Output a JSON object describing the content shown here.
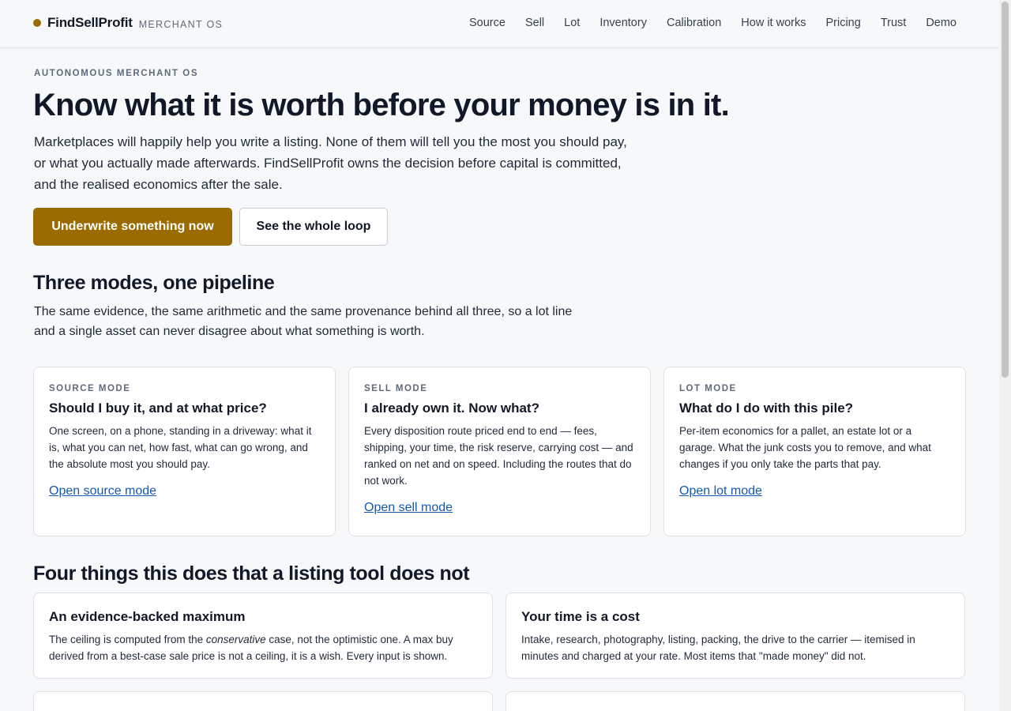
{
  "header": {
    "brand_name": "FindSellProfit",
    "brand_tag": "MERCHANT OS",
    "nav": [
      "Source",
      "Sell",
      "Lot",
      "Inventory",
      "Calibration",
      "How it works",
      "Pricing",
      "Trust",
      "Demo"
    ]
  },
  "hero": {
    "eyebrow": "AUTONOMOUS MERCHANT OS",
    "title": "Know what it is worth before your money is in it.",
    "lede": "Marketplaces will happily help you write a listing. None of them will tell you the most you should pay, or what you actually made afterwards. FindSellProfit owns the decision before capital is committed, and the realised economics after the sale.",
    "primary_cta": "Underwrite something now",
    "secondary_cta": "See the whole loop"
  },
  "modes": {
    "title": "Three modes, one pipeline",
    "lede": "The same evidence, the same arithmetic and the same provenance behind all three, so a lot line and a single asset can never disagree about what something is worth.",
    "cards": [
      {
        "eyebrow": "SOURCE MODE",
        "title": "Should I buy it, and at what price?",
        "body": "One screen, on a phone, standing in a driveway: what it is, what you can net, how fast, what can go wrong, and the absolute most you should pay.",
        "link": "Open source mode"
      },
      {
        "eyebrow": "SELL MODE",
        "title": "I already own it. Now what?",
        "body": "Every disposition route priced end to end — fees, shipping, your time, the risk reserve, carrying cost — and ranked on net and on speed. Including the routes that do not work.",
        "link": "Open sell mode"
      },
      {
        "eyebrow": "LOT MODE",
        "title": "What do I do with this pile?",
        "body": "Per-item economics for a pallet, an estate lot or a garage. What the junk costs you to remove, and what changes if you only take the parts that pay.",
        "link": "Open lot mode"
      }
    ]
  },
  "features": {
    "title": "Four things this does that a listing tool does not",
    "cards": [
      {
        "title": "An evidence-backed maximum",
        "body_pre": "The ceiling is computed from the ",
        "body_em": "conservative",
        "body_post": " case, not the optimistic one. A max buy derived from a best-case sale price is not a ceiling, it is a wish. Every input is shown."
      },
      {
        "title": "Your time is a cost",
        "body": "Intake, research, photography, listing, packing, the drive to the carrier — itemised in minutes and charged at your rate. Most items that \"made money\" did not."
      }
    ]
  }
}
